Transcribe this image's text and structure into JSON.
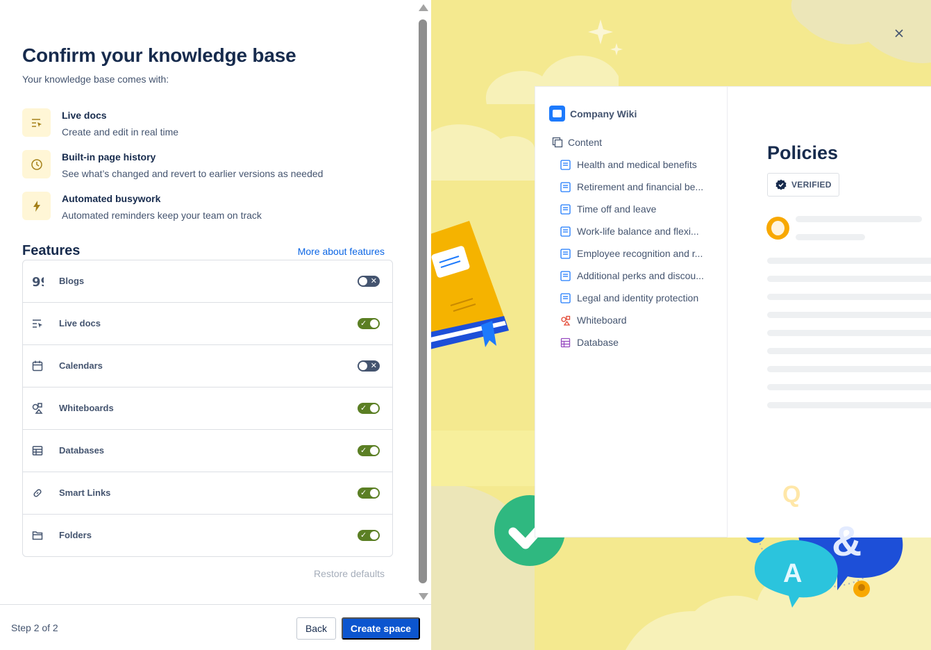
{
  "modal": {
    "title": "Confirm your knowledge base",
    "subtitle": "Your knowledge base comes with:",
    "benefits": [
      {
        "icon": "live-doc-icon",
        "title": "Live docs",
        "desc": "Create and edit in real time"
      },
      {
        "icon": "clock-icon",
        "title": "Built-in page history",
        "desc": "See what’s changed and revert to earlier versions as needed"
      },
      {
        "icon": "lightning-icon",
        "title": "Automated busywork",
        "desc": "Automated reminders keep your team on track"
      }
    ],
    "features_heading": "Features",
    "more_link": "More about features",
    "features": [
      {
        "icon": "quote-icon",
        "label": "Blogs",
        "enabled": false
      },
      {
        "icon": "live-doc-icon",
        "label": "Live docs",
        "enabled": true
      },
      {
        "icon": "calendar-icon",
        "label": "Calendars",
        "enabled": false
      },
      {
        "icon": "whiteboard-icon",
        "label": "Whiteboards",
        "enabled": true
      },
      {
        "icon": "database-icon",
        "label": "Databases",
        "enabled": true
      },
      {
        "icon": "link-icon",
        "label": "Smart Links",
        "enabled": true
      },
      {
        "icon": "folder-icon",
        "label": "Folders",
        "enabled": true
      }
    ],
    "restore_defaults": "Restore defaults",
    "footer": {
      "step": "Step 2 of 2",
      "back": "Back",
      "create": "Create space"
    }
  },
  "preview": {
    "space_name": "Company Wiki",
    "content_label": "Content",
    "tree": [
      {
        "icon": "page-icon",
        "label": "Health and medical benefits"
      },
      {
        "icon": "page-icon",
        "label": "Retirement and financial be..."
      },
      {
        "icon": "page-icon",
        "label": "Time off and leave"
      },
      {
        "icon": "page-icon",
        "label": "Work-life balance and flexi..."
      },
      {
        "icon": "page-icon",
        "label": "Employee recognition and r..."
      },
      {
        "icon": "page-icon",
        "label": "Additional perks and discou..."
      },
      {
        "icon": "page-icon",
        "label": "Legal and identity protection"
      },
      {
        "icon": "whiteboard-icon",
        "label": "Whiteboard"
      },
      {
        "icon": "database-icon",
        "label": "Database"
      }
    ],
    "page_title": "Policies",
    "verified_label": "VERIFIED",
    "qa_illustration": {
      "letters": [
        "Q",
        "&",
        "A"
      ]
    }
  },
  "colors": {
    "accent_blue": "#0c55cf",
    "toggle_on": "#5b7f24",
    "toggle_off": "#44546f",
    "illustration_bg": "#f4e98f"
  }
}
